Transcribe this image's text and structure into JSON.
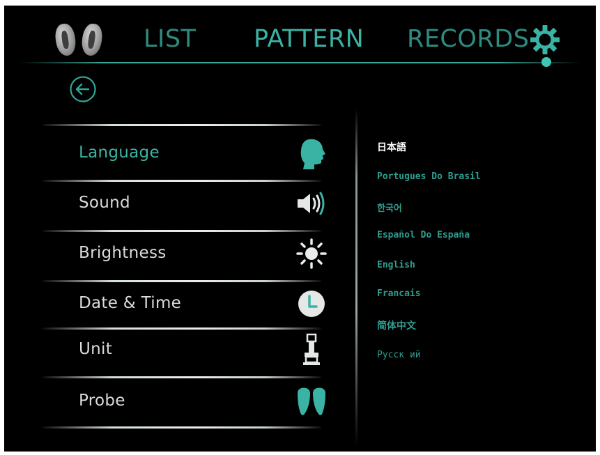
{
  "header": {
    "tabs": [
      {
        "label": "LIST"
      },
      {
        "label": "PATTERN"
      },
      {
        "label": "RECORDS"
      }
    ]
  },
  "settings": {
    "items": [
      {
        "label": "Language",
        "icon": "speaking-head-icon",
        "active": true
      },
      {
        "label": "Sound",
        "icon": "speaker-icon"
      },
      {
        "label": "Brightness",
        "icon": "sun-icon"
      },
      {
        "label": "Date & Time",
        "icon": "clock-icon"
      },
      {
        "label": "Unit",
        "icon": "unit-gauge-icon"
      },
      {
        "label": "Probe",
        "icon": "probe-pair-icon"
      }
    ]
  },
  "languages": {
    "selected": "日本語",
    "options": [
      "日本語",
      "Portugues Do Brasil",
      "한국어",
      "Español Do España",
      "English",
      "Francais",
      "简体中文",
      "Pусск ий"
    ]
  },
  "colors": {
    "accent": "#3bb3a4",
    "background": "#000000",
    "text": "#d8dcdb"
  }
}
